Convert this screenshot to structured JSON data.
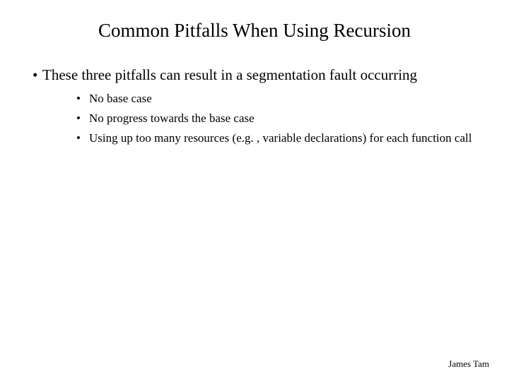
{
  "title": "Common Pitfalls When Using Recursion",
  "lead": "These three pitfalls can result in a segmentation fault occurring",
  "items": [
    "No base case",
    "No progress towards the base case",
    "Using up too many resources (e.g. , variable declarations) for each function call"
  ],
  "footer": "James Tam"
}
